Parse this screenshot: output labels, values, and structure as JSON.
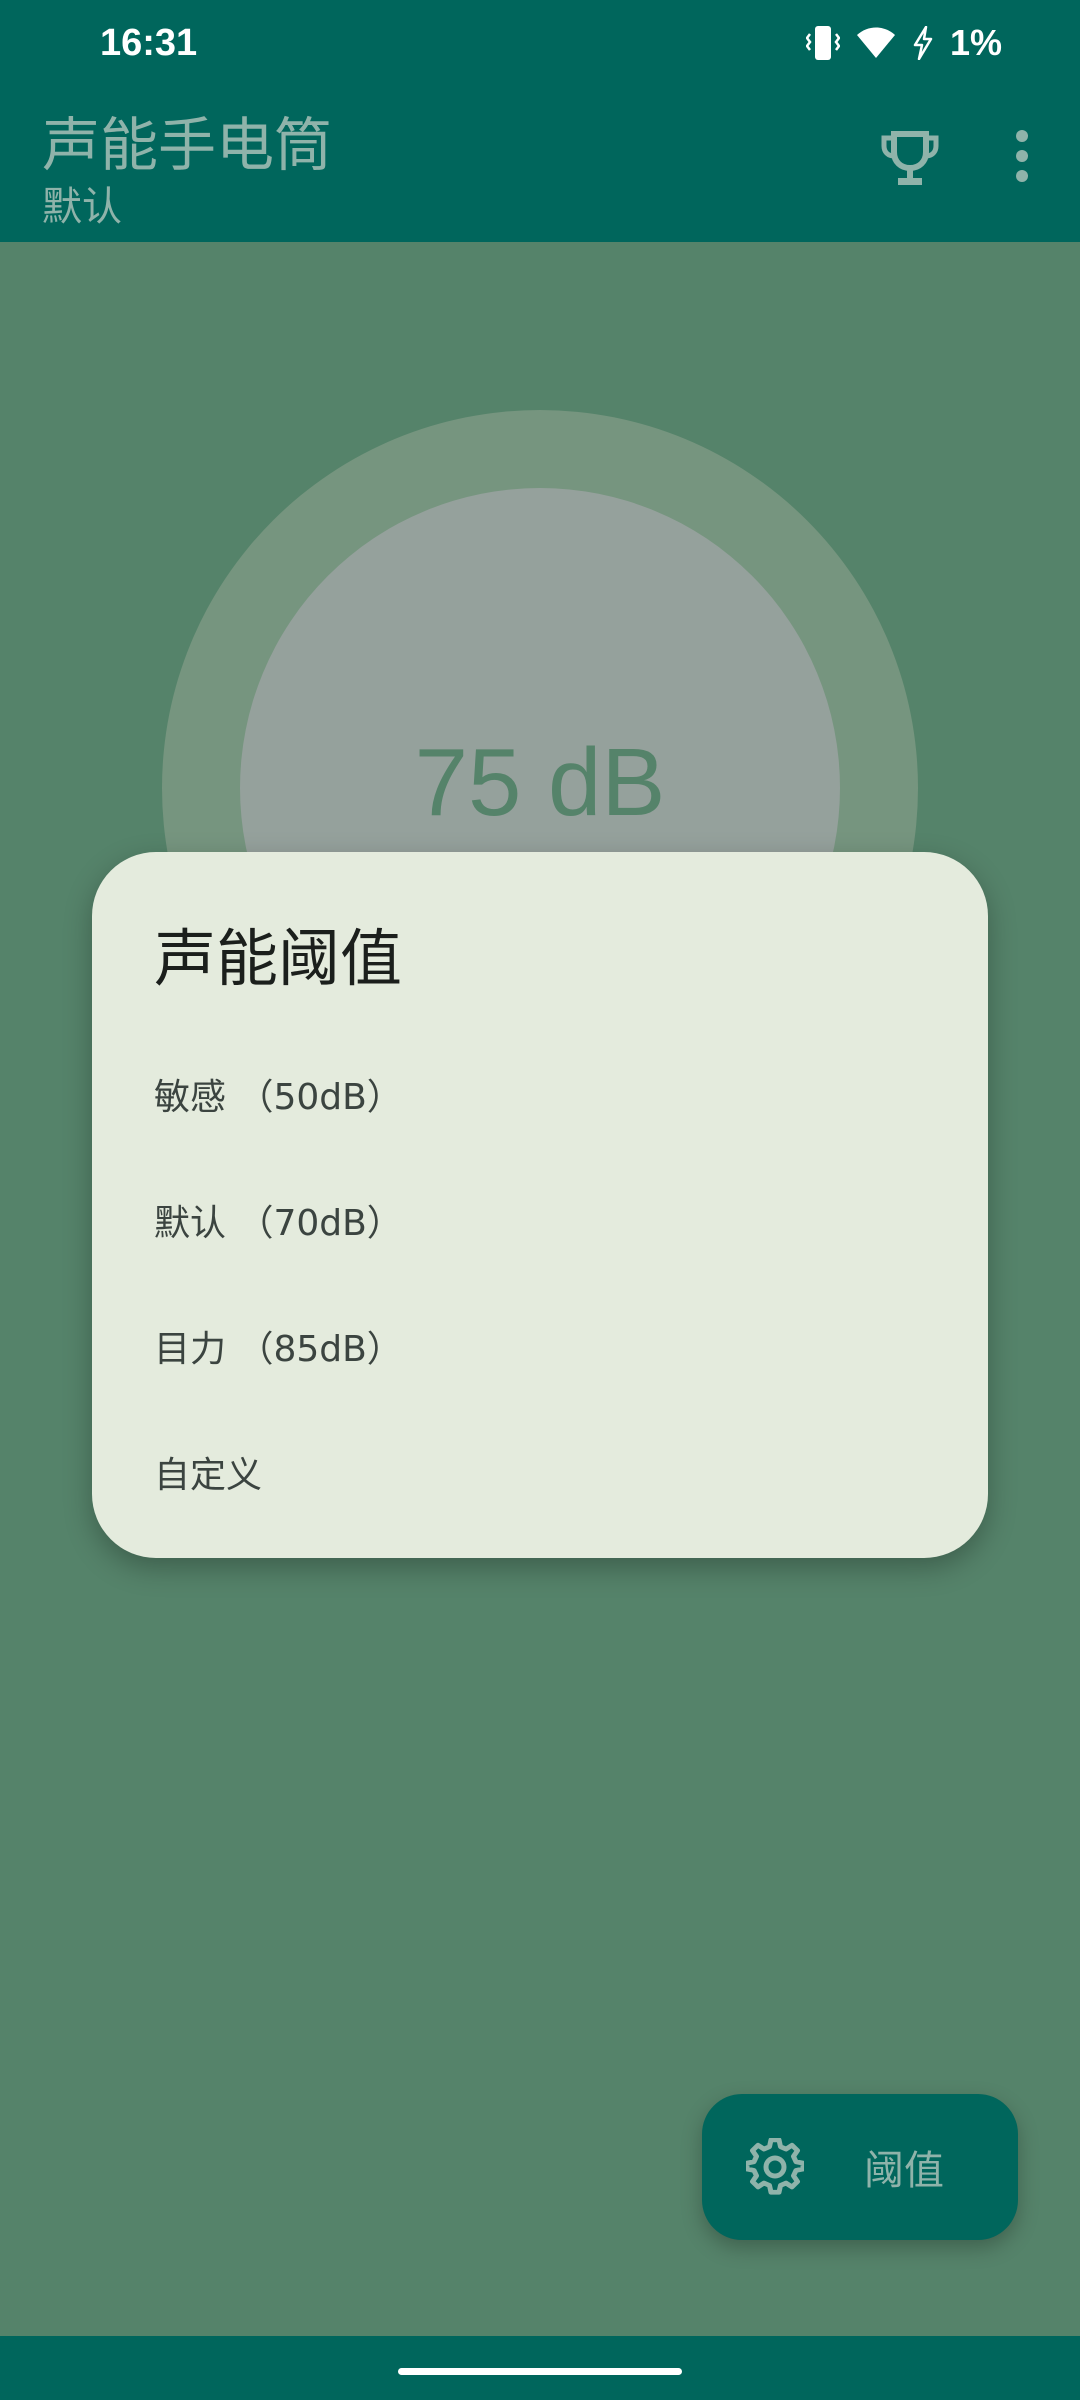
{
  "status_bar": {
    "time": "16:31",
    "battery": "1%",
    "icons": [
      "vibrate-icon",
      "wifi-icon",
      "charging-icon"
    ]
  },
  "app_bar": {
    "title": "声能手电筒",
    "subtitle": "默认",
    "actions": [
      "trophy-icon",
      "more-vert-icon"
    ]
  },
  "meter": {
    "value": "75 dB"
  },
  "dialog": {
    "title": "声能阈值",
    "options": [
      {
        "label": "敏感 （50dB）"
      },
      {
        "label": "默认 （70dB）"
      },
      {
        "label": "目力 （85dB）"
      },
      {
        "label": "自定义"
      }
    ]
  },
  "fab": {
    "icon": "gear-icon",
    "label": "阈值"
  },
  "colors": {
    "primary": "#00665c",
    "background": "#55836a",
    "dialog": "#e4ebdd",
    "muted_text": "#8fb3aa"
  }
}
